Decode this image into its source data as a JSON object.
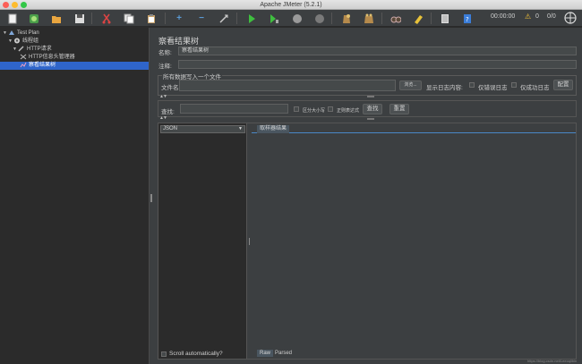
{
  "window": {
    "title": "Apache JMeter (5.2.1)"
  },
  "toolbar": {
    "timer": "00:00:00",
    "warning_count": "0",
    "thread_ratio": "0/0"
  },
  "tree": {
    "items": [
      {
        "label": "Test Plan"
      },
      {
        "label": "线程组"
      },
      {
        "label": "HTTP请求"
      },
      {
        "label": "HTTP信息头管理器"
      },
      {
        "label": "察看结果树"
      }
    ]
  },
  "panel": {
    "title": "察看结果树",
    "name_label": "名称:",
    "name_value": "察看结果树",
    "comment_label": "注释:",
    "comment_value": "",
    "file_group_title": "所有数据写入一个文件",
    "filename_label": "文件名",
    "filename_value": "",
    "browse_label": "浏览...",
    "log_content_label": "显示日志内容:",
    "errors_only_label": "仅错误日志",
    "success_only_label": "仅成功日志",
    "configure_label": "配置",
    "search_label": "查找:",
    "search_value": "",
    "case_sensitive_label": "区分大小写",
    "regex_label": "正则表达式",
    "find_button": "查找",
    "reset_button": "重置"
  },
  "results": {
    "renderer": "JSON",
    "tab_label": "取样器结果",
    "scroll_auto_label": "Scroll automatically?",
    "raw_tab": "Raw",
    "parsed_tab": "Parsed"
  },
  "watermark": "https://blog.csdn.net/Leeoqlibin"
}
